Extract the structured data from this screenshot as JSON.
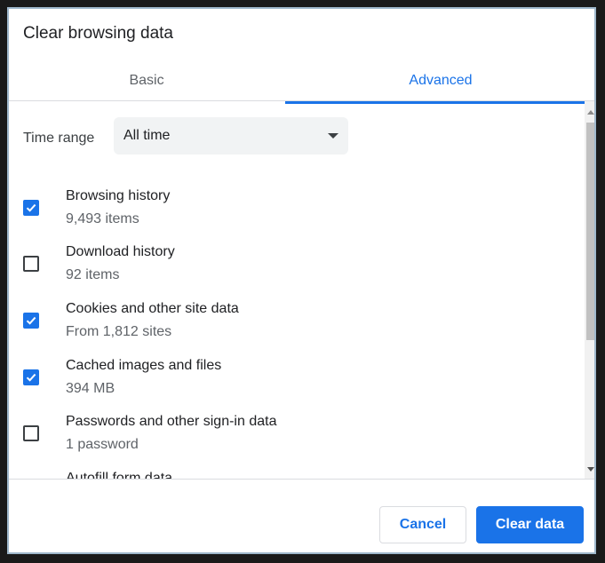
{
  "dialog": {
    "title": "Clear browsing data"
  },
  "tabs": [
    {
      "label": "Basic",
      "selected": false
    },
    {
      "label": "Advanced",
      "selected": true
    }
  ],
  "time_range": {
    "label": "Time range",
    "value": "All time"
  },
  "items": [
    {
      "label": "Browsing history",
      "sub": "9,493 items",
      "checked": true
    },
    {
      "label": "Download history",
      "sub": "92 items",
      "checked": false
    },
    {
      "label": "Cookies and other site data",
      "sub": "From 1,812 sites",
      "checked": true
    },
    {
      "label": "Cached images and files",
      "sub": "394 MB",
      "checked": true
    },
    {
      "label": "Passwords and other sign-in data",
      "sub": "1 password",
      "checked": false
    },
    {
      "label": "Autofill form data",
      "sub": "",
      "checked": false
    }
  ],
  "buttons": {
    "cancel": "Cancel",
    "clear": "Clear data"
  },
  "colors": {
    "accent": "#1a73e8",
    "frame": "#9fb8cc"
  }
}
